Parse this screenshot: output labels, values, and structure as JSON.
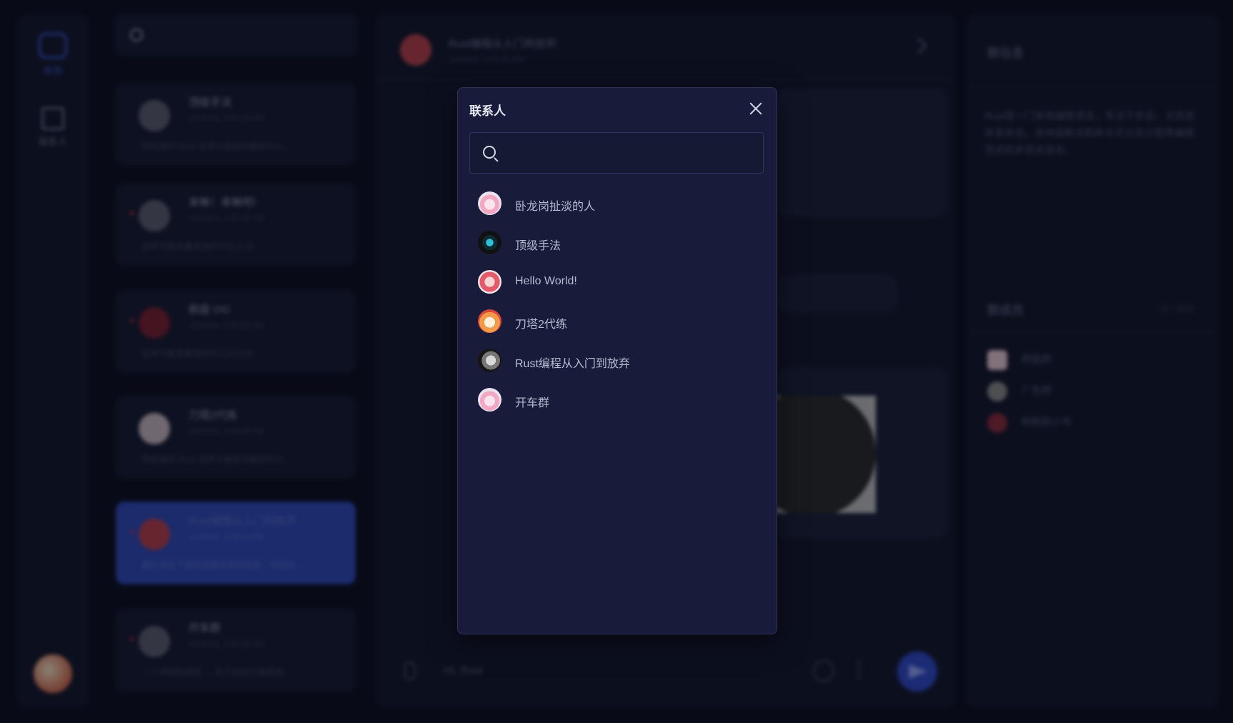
{
  "sidebar": {
    "chat_label": "会话",
    "contacts_label": "联系人"
  },
  "chat_list": {
    "items": [
      {
        "name": "顶级手法",
        "time": "1/1/2021, 3:45:25 PM",
        "preview": "你知道吗 Rust 这样才能找到最好的人...",
        "unread": false
      },
      {
        "name": "来嘛！来嘛吧!",
        "time": "1/1/2021, 3:45:25 PM",
        "preview": "这样可能是最高效的讨论方式...",
        "unread": true
      },
      {
        "name": "刷盘 OG",
        "time": "1/1/2021, 3:45:25 PM",
        "preview": "这样可能是最高效的讨论方式...",
        "unread": true
      },
      {
        "name": "刀塔2代练",
        "time": "1/1/2021, 3:45:25 PM",
        "preview": "你知道吗 Rust 这样才能找到最好的人...",
        "unread": false
      },
      {
        "name": "Rust编程从入门到放弃",
        "time": "1/1/2021, 3:45:25 PM",
        "preview": "我们决定了如何收集所有的信息，并且你...",
        "unread": true
      },
      {
        "name": "开车群",
        "time": "1/1/2021, 3:45:25 PM",
        "preview": "一个详细的描述 → 关于如何正确使用...",
        "unread": true
      }
    ]
  },
  "main": {
    "title": "Rust编程从入门到放弃",
    "subtitle": "1/1/2021, 3:45:25 PM",
    "composer_placeholder": "Hi, Rust"
  },
  "info": {
    "group_info_title": "群信息",
    "description": "Rust是一门系统编程语言，专注于安全，尤其是并发安全，支持函数式和命令式以及泛型等编程范式的多范式语言。",
    "members_title": "群成员",
    "member_count": "(3 / 100)",
    "members": [
      {
        "name": "刷盘群",
        "color": "#e7c8d2"
      },
      {
        "name": "广告群",
        "color": "#8a8a8a"
      },
      {
        "name": "刷刷刷小号",
        "color": "#8a2a3a"
      }
    ]
  },
  "modal": {
    "title": "联系人",
    "search_placeholder": "",
    "contacts": [
      {
        "name": "卧龙岗扯淡的人",
        "avatar": "pink-avatar"
      },
      {
        "name": "顶级手法",
        "avatar": "dark-avatar"
      },
      {
        "name": "Hello World!",
        "avatar": "red-avatar"
      },
      {
        "name": "刀塔2代练",
        "avatar": "fox-avatar"
      },
      {
        "name": "Rust编程从入门到放弃",
        "avatar": "grey-avatar"
      },
      {
        "name": "开车群",
        "avatar": "pink-avatar"
      }
    ]
  }
}
